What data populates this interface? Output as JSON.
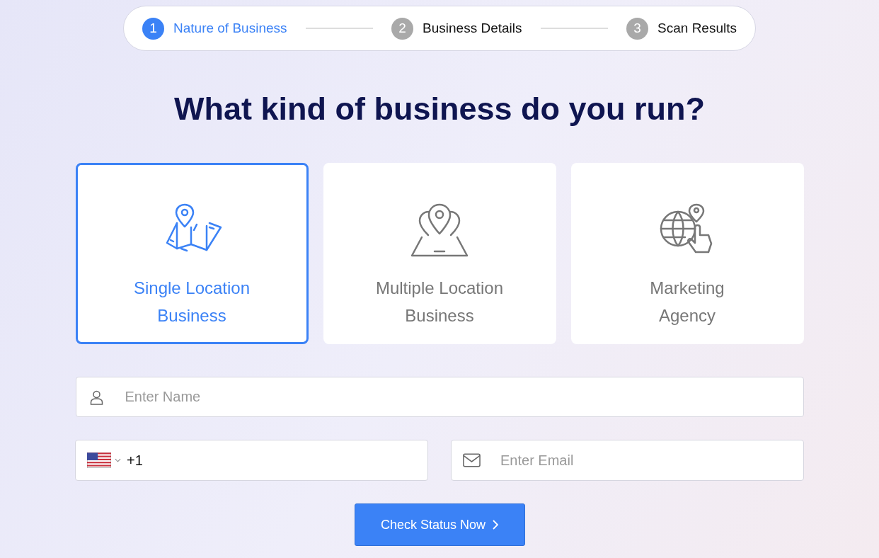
{
  "stepper": [
    {
      "number": "1",
      "label": "Nature of Business",
      "selected": true
    },
    {
      "number": "2",
      "label": "Business Details",
      "selected": false
    },
    {
      "number": "3",
      "label": "Scan Results",
      "selected": false
    }
  ],
  "heading": "What kind of business do you run?",
  "options": [
    {
      "kind": "map",
      "lines": [
        "Single Location",
        "Business"
      ],
      "selected": true
    },
    {
      "kind": "pins",
      "lines": [
        "Multiple Location",
        "Business"
      ],
      "selected": false
    },
    {
      "kind": "globe",
      "lines": [
        "Marketing",
        "Agency"
      ],
      "selected": false
    }
  ],
  "name_field": {
    "placeholder": "Enter Name"
  },
  "phone_field": {
    "value": "+1"
  },
  "email_field": {
    "placeholder": "Enter Email"
  },
  "submit_button": "Check Status Now"
}
